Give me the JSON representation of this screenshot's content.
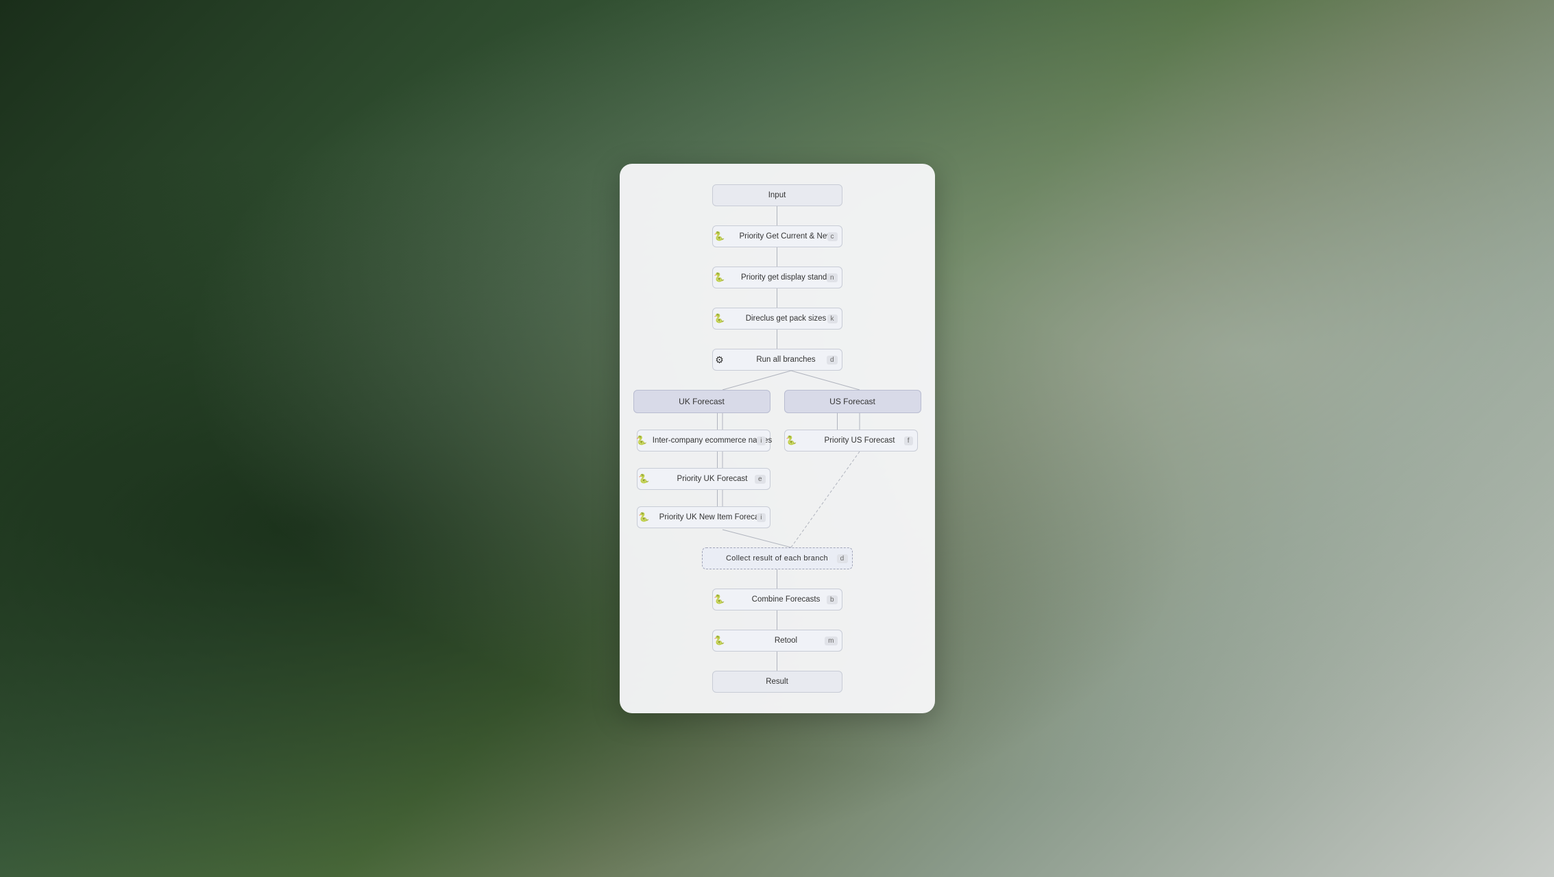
{
  "background": {
    "description": "Forest with fog"
  },
  "panel": {
    "nodes": {
      "input": {
        "label": "Input"
      },
      "priority_get_current_new": {
        "label": "Priority Get Current & New",
        "key": "c",
        "icon": "python"
      },
      "priority_get_display_stands": {
        "label": "Priority get display stands",
        "key": "n",
        "icon": "python"
      },
      "direclus_get_pack_sizes": {
        "label": "Direclus get pack sizes",
        "key": "k",
        "icon": "python"
      },
      "run_all_branches": {
        "label": "Run all branches",
        "key": "d",
        "icon": "fork"
      },
      "uk_forecast_header": {
        "label": "UK Forecast"
      },
      "us_forecast_header": {
        "label": "US Forecast"
      },
      "inter_company_ecommerce": {
        "label": "Inter-company ecommerce names",
        "key": "i",
        "icon": "python"
      },
      "priority_us_forecast": {
        "label": "Priority US Forecast",
        "key": "f",
        "icon": "python"
      },
      "priority_uk_forecast": {
        "label": "Priority UK Forecast",
        "key": "e",
        "icon": "python"
      },
      "priority_uk_new_item": {
        "label": "Priority UK New Item Forecast",
        "key": "i",
        "icon": "python"
      },
      "collect_result": {
        "label": "Collect result of each branch",
        "key": "d"
      },
      "combine_forecasts": {
        "label": "Combine Forecasts",
        "key": "b",
        "icon": "python"
      },
      "retool": {
        "label": "Retool",
        "key": "m",
        "icon": "python"
      },
      "result": {
        "label": "Result"
      }
    }
  }
}
